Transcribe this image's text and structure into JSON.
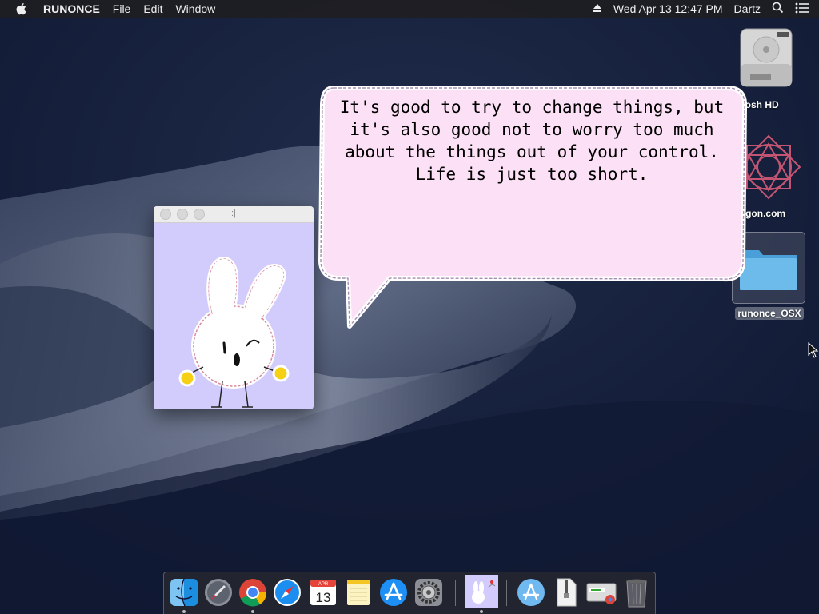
{
  "menubar": {
    "app_name": "RUNONCE",
    "menus": [
      "File",
      "Edit",
      "Window"
    ],
    "datetime": "Wed Apr 13  12:47 PM",
    "user": "Dartz"
  },
  "desktop_icons": [
    {
      "label": "cintosh HD",
      "icon": "hard-drive-icon"
    },
    {
      "label": "aWagon.com",
      "icon": "geometric-pattern-icon"
    },
    {
      "label": "runonce_OSX",
      "icon": "folder-icon"
    }
  ],
  "bunny_window": {
    "title": ":|"
  },
  "speech_bubble": {
    "lines": [
      "It's good to try to change things, but",
      "it's also good not to worry too much",
      "about the things out of your control.",
      "Life is just too short."
    ]
  },
  "dock": {
    "calendar_month": "APR",
    "calendar_day": "13",
    "items": [
      "finder",
      "launchpad",
      "chrome",
      "safari",
      "calendar",
      "notes",
      "app-store",
      "system-preferences",
      "runonce",
      "applications",
      "zip-archive",
      "chrome-installer",
      "trash"
    ]
  },
  "colors": {
    "bubble_fill": "#fce1f6",
    "bubble_outline": "#a58fb0",
    "bunny_window_bg": "#d1ccfb",
    "menubar_bg": "#1e1e22"
  }
}
